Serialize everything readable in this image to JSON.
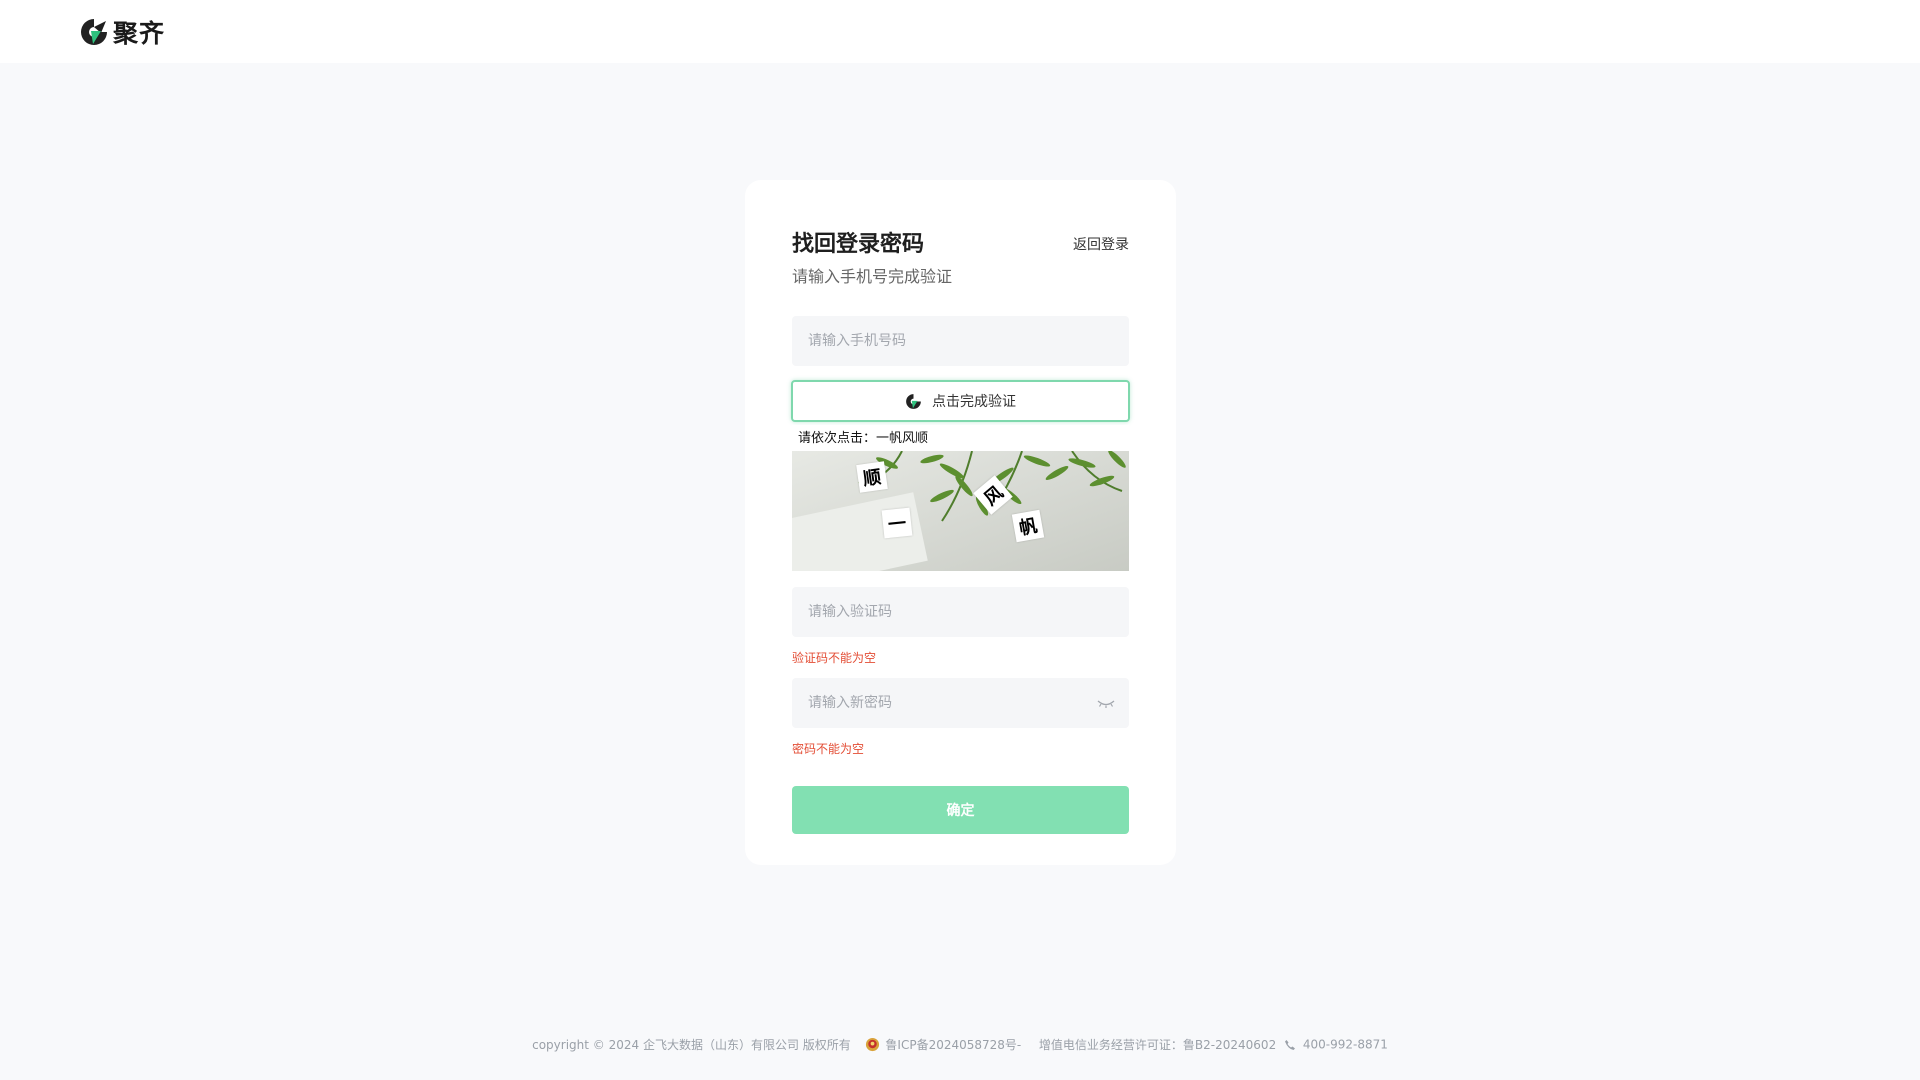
{
  "header": {
    "brand_name": "聚齐",
    "logo_icon": "juqi-logo-icon"
  },
  "card": {
    "title": "找回登录密码",
    "back_link": "返回登录",
    "subtitle": "请输入手机号完成验证"
  },
  "form": {
    "phone_placeholder": "请输入手机号码",
    "captcha_button_label": "点击完成验证",
    "captcha_prompt": "请依次点击：一帆风顺",
    "captcha_chars": [
      "顺",
      "风",
      "一",
      "帆"
    ],
    "code_placeholder": "请输入验证码",
    "code_error": "验证码不能为空",
    "password_placeholder": "请输入新密码",
    "password_error": "密码不能为空",
    "submit_label": "确定"
  },
  "footer": {
    "copyright": "copyright © 2024 企飞大数据（山东）有限公司 版权所有",
    "icp": "鲁ICP备2024058728号-",
    "license": "增值电信业务经营许可证：鲁B2-20240602",
    "phone": "400-992-8871"
  },
  "colors": {
    "accent": "#82e0b2",
    "captcha_border": "#7fd8ad",
    "error": "#e34d35",
    "background": "#f8f9fb"
  }
}
